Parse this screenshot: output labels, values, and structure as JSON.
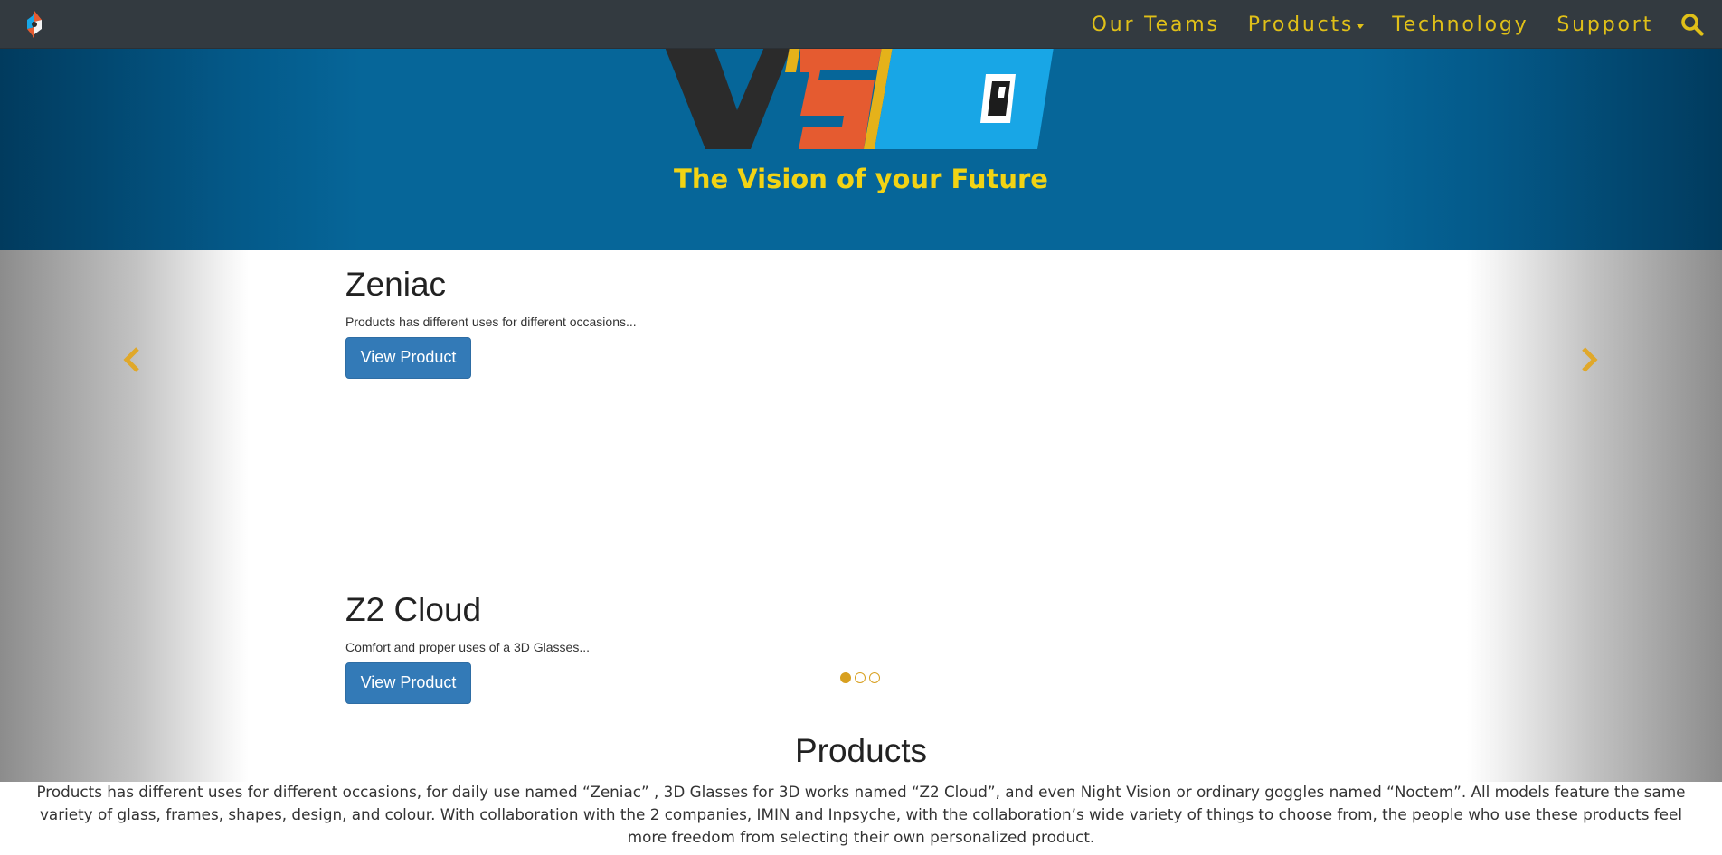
{
  "nav": {
    "links": [
      "Our Teams",
      "Products",
      "Technology",
      "Support"
    ],
    "icons": {
      "brand": "vision-brand-icon",
      "search": "search-icon"
    },
    "accent_color": "#e0c018",
    "background_color": "#333a40"
  },
  "hero": {
    "logo_text": "VS",
    "tagline": "The Vision of your Future",
    "background_color": "#066699",
    "tagline_color": "#f2d314"
  },
  "carousel": {
    "slides": [
      {
        "title": "Zeniac",
        "description": "Products has different uses for different occasions...",
        "button_label": "View Product"
      },
      {
        "title": "Z2 Cloud",
        "description": "Comfort and proper uses of a 3D Glasses...",
        "button_label": "View Product"
      }
    ],
    "indicator_count": 3,
    "active_indicator": 1,
    "icons": {
      "prev": "chevron-left-icon",
      "next": "chevron-right-icon"
    },
    "accent_color": "#d8a020",
    "button_color": "#337ab7"
  },
  "products_section": {
    "title": "Products",
    "body": "Products has different uses for different occasions, for daily use named “Zeniac” , 3D Glasses for 3D works named “Z2 Cloud”, and even Night Vision or ordinary goggles named “Noctem”. All models feature the same variety of glass, frames, shapes, design, and colour. With collaboration with the 2 companies, IMIN and Inpsyche, with the collaboration’s wide variety of things to choose from, the people who use these products feel more freedom from selecting their own personalized product."
  }
}
